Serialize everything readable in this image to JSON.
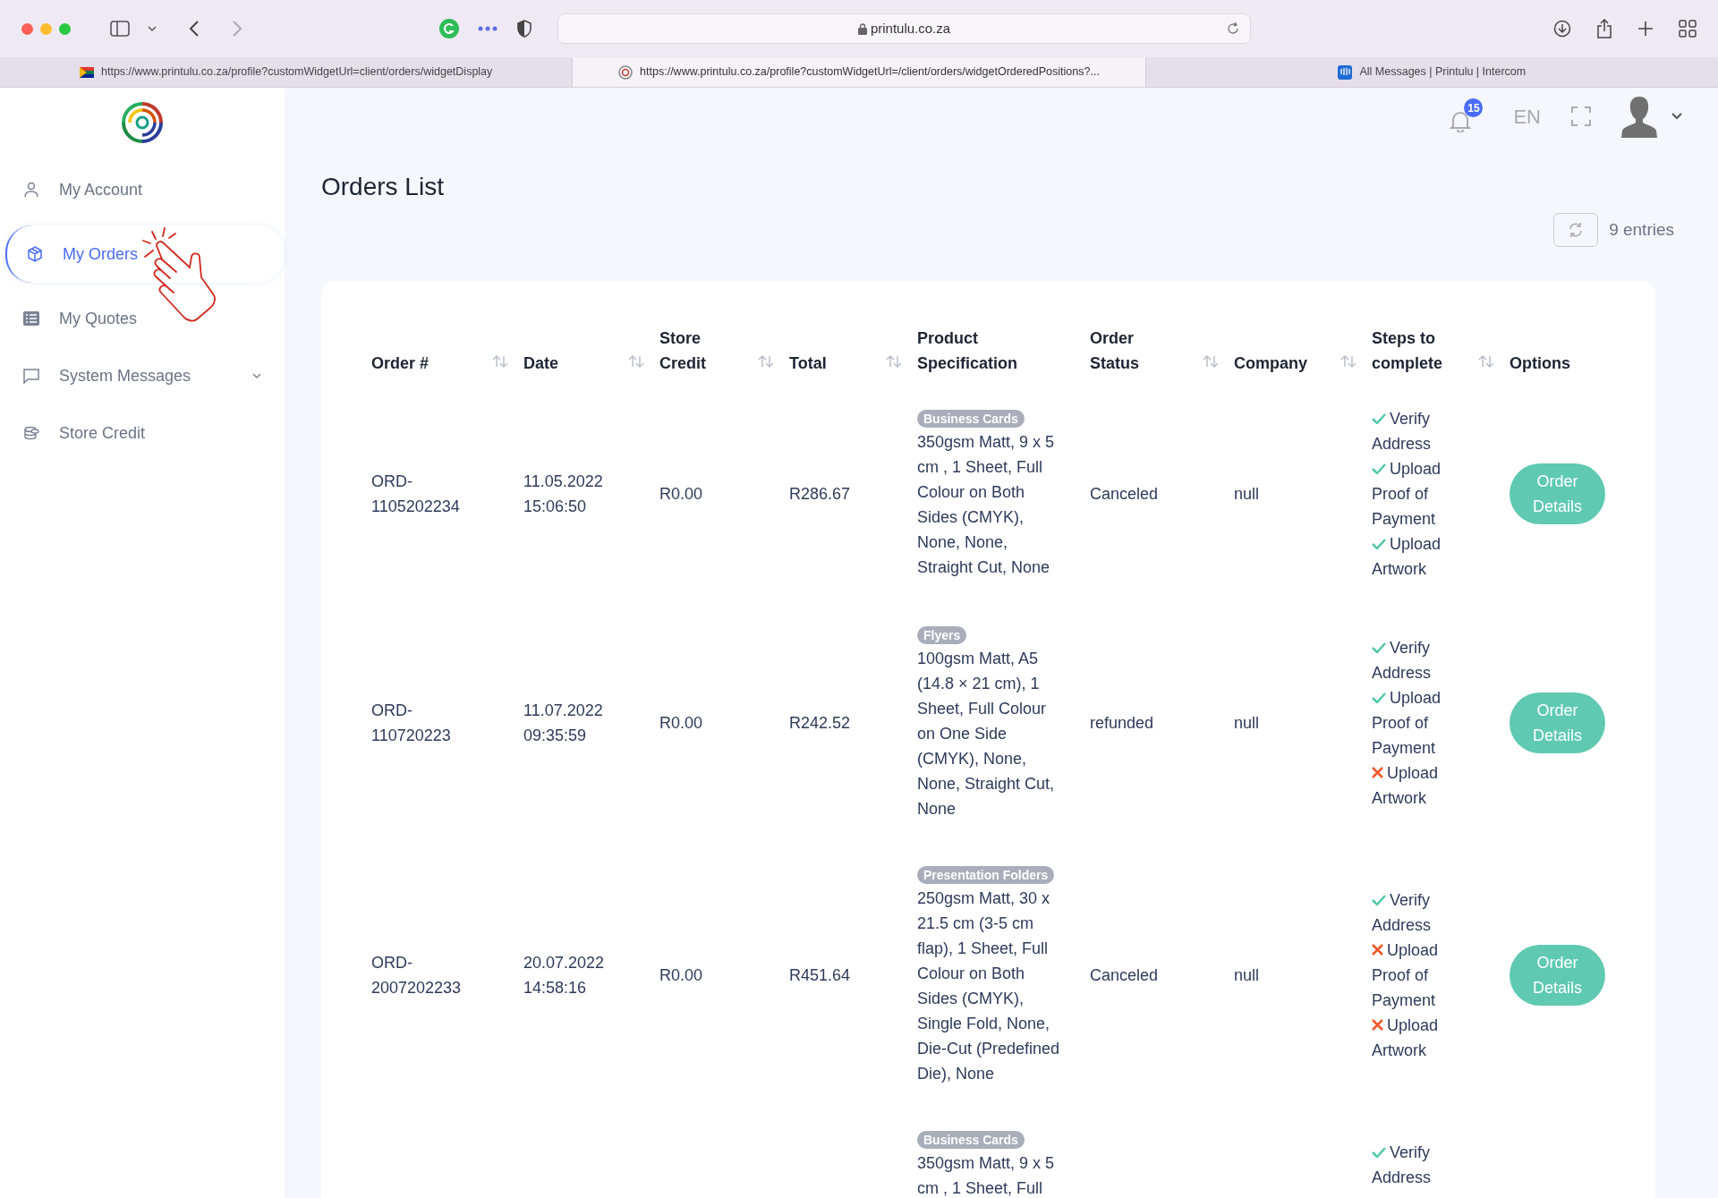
{
  "browser": {
    "address": "printulu.co.za",
    "tabs": [
      {
        "title": "https://www.printulu.co.za/profile?customWidgetUrl=client/orders/widgetDisplay",
        "selected": false
      },
      {
        "title": "https://www.printulu.co.za/profile?customWidgetUrl=/client/orders/widgetOrderedPositions?...",
        "selected": true
      },
      {
        "title": "All Messages | Printulu | Intercom",
        "selected": false
      }
    ]
  },
  "sidebar": {
    "items": [
      {
        "label": "My Account",
        "selected": false,
        "has_submenu": false
      },
      {
        "label": "My Orders",
        "selected": true,
        "has_submenu": false
      },
      {
        "label": "My Quotes",
        "selected": false,
        "has_submenu": false
      },
      {
        "label": "System Messages",
        "selected": false,
        "has_submenu": true
      },
      {
        "label": "Store Credit",
        "selected": false,
        "has_submenu": false
      }
    ]
  },
  "header": {
    "notification_count": "15",
    "language": "EN"
  },
  "page": {
    "title": "Orders List",
    "entries": "9 entries"
  },
  "table": {
    "columns": [
      {
        "label": "Order #",
        "sortable": true
      },
      {
        "label": "Date",
        "sortable": true
      },
      {
        "label": "Store Credit",
        "sortable": true
      },
      {
        "label": "Total",
        "sortable": true
      },
      {
        "label": "Product Specification",
        "sortable": false
      },
      {
        "label": "Order Status",
        "sortable": true
      },
      {
        "label": "Company",
        "sortable": true
      },
      {
        "label": "Steps to complete",
        "sortable": true
      },
      {
        "label": "Options",
        "sortable": false
      }
    ],
    "rows": [
      {
        "order": "ORD-1105202234",
        "date": "11.05.2022 15:06:50",
        "store_credit": "R0.00",
        "total": "R286.67",
        "category": "Business Cards",
        "specification": "350gsm Matt, 9 x 5 cm , 1 Sheet, Full Colour on Both Sides (CMYK), None, None, Straight Cut, None",
        "status": "Canceled",
        "company": "null",
        "steps": [
          {
            "label": "Verify Address",
            "done": true
          },
          {
            "label": "Upload Proof of Payment",
            "done": true
          },
          {
            "label": "Upload Artwork",
            "done": true
          }
        ],
        "button": "Order Details"
      },
      {
        "order": "ORD-110720223",
        "date": "11.07.2022 09:35:59",
        "store_credit": "R0.00",
        "total": "R242.52",
        "category": "Flyers",
        "specification": "100gsm Matt, A5 (14.8 × 21 cm), 1 Sheet, Full Colour on One Side (CMYK), None, None, Straight Cut, None",
        "status": "refunded",
        "company": "null",
        "steps": [
          {
            "label": "Verify Address",
            "done": true
          },
          {
            "label": "Upload Proof of Payment",
            "done": true
          },
          {
            "label": "Upload Artwork",
            "done": false
          }
        ],
        "button": "Order Details"
      },
      {
        "order": "ORD-2007202233",
        "date": "20.07.2022 14:58:16",
        "store_credit": "R0.00",
        "total": "R451.64",
        "category": "Presentation Folders",
        "specification": "250gsm Matt, 30 x 21.5 cm (3-5 cm flap), 1 Sheet, Full Colour on Both Sides (CMYK), Single Fold, None, Die-Cut (Predefined Die), None",
        "status": "Canceled",
        "company": "null",
        "steps": [
          {
            "label": "Verify Address",
            "done": true
          },
          {
            "label": "Upload Proof of Payment",
            "done": false
          },
          {
            "label": "Upload Artwork",
            "done": false
          }
        ],
        "button": "Order Details"
      },
      {
        "category": "Business Cards",
        "specification": "350gsm Matt, 9 x 5 cm , 1 Sheet, Full",
        "steps": [
          {
            "label": "Verify Address",
            "done": true
          }
        ]
      }
    ]
  }
}
